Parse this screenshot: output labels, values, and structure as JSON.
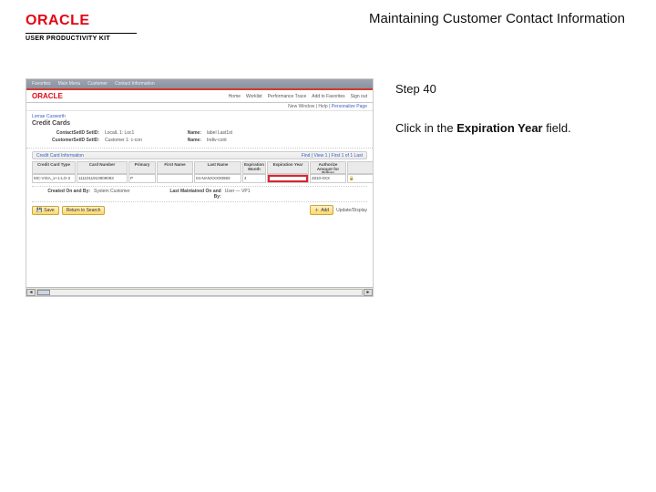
{
  "brand": {
    "logo": "ORACLE",
    "subtitle": "USER PRODUCTIVITY KIT"
  },
  "doc_title": "Maintaining Customer Contact Information",
  "step": {
    "label": "Step 40",
    "instruction_prefix": "Click in the ",
    "instruction_bold": "Expiration Year",
    "instruction_suffix": " field."
  },
  "shot": {
    "topbar": [
      "Favorites",
      "Main Menu",
      "Customer",
      "Contact Information"
    ],
    "logo": "ORACLE",
    "nav": [
      "Home",
      "Worklist",
      "Performance Trace",
      "Add to Favorites",
      "Sign out"
    ],
    "userline_prefix": "New Window | Help | ",
    "userline_link": "Personalize Page",
    "context_line1": "Lorrae Cusworth",
    "context_line2": "Credit Cards",
    "info": {
      "l1": "ContactSetID SetID:",
      "v1": "LocalL 1: Loc1",
      "l1b": "Name:",
      "v1b": "label Last1st",
      "l2": "CustomerSetID SetID:",
      "v2": "Customer 1: c-con",
      "l2b": "Name:",
      "v2b": "Indiv-cont"
    },
    "section": "Credit Card Information",
    "section_right": "Find | View 1 | First 1 of 1 Last",
    "headers": [
      "Credit Card Type",
      "Card Number",
      "Primary",
      "First Name",
      "Last Name",
      "Expiration Month",
      "Expiration Year",
      "Authorize Amount for Billing",
      ""
    ],
    "row": [
      "MC-VISA_x+1-LO-2",
      "1111011910909093",
      "P",
      "",
      "04-NANXXX00983",
      "4",
      "",
      "2810-0XX"
    ],
    "row_lock": "🔒",
    "status": {
      "l1": "Created On and By:",
      "v1": "System Customer",
      "l2": "Last Maintained On and By:",
      "v2": "User — VP1"
    },
    "buttons": {
      "save": "Save",
      "return": "Return to Search"
    },
    "add": {
      "label": "Add",
      "upd": "Update/Display"
    }
  }
}
